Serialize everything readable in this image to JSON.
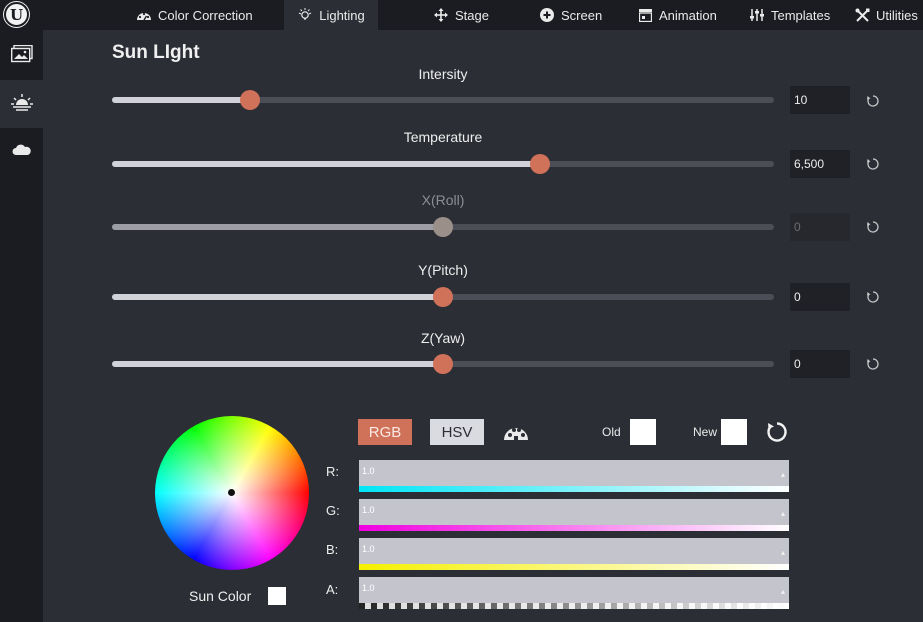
{
  "topbar": {
    "logo": "U",
    "tabs": [
      {
        "label": "Color Correction",
        "icon": "gauge-icon"
      },
      {
        "label": "Lighting",
        "icon": "lightbulb-icon",
        "active": true
      },
      {
        "label": "Stage",
        "icon": "move-arrows-icon"
      },
      {
        "label": "Screen",
        "icon": "plus-circle-icon"
      },
      {
        "label": "Animation",
        "icon": "clapperboard-icon"
      },
      {
        "label": "Templates",
        "icon": "sliders-icon"
      },
      {
        "label": "Utilities",
        "icon": "tools-icon"
      }
    ]
  },
  "leftrail": {
    "items": [
      {
        "icon": "image-gallery-icon"
      },
      {
        "icon": "sunrise-icon",
        "active": true
      },
      {
        "icon": "cloud-icon"
      }
    ]
  },
  "panel": {
    "title": "Sun  LIght",
    "sliders": [
      {
        "label": "Intersity",
        "value": "10",
        "fraction": 0.209,
        "disabled": false
      },
      {
        "label": "Temperature",
        "value": "6,500",
        "fraction": 0.647,
        "disabled": false
      },
      {
        "label": "X(Roll)",
        "value": "0",
        "fraction": 0.5,
        "disabled": true
      },
      {
        "label": "Y(Pitch)",
        "value": "0",
        "fraction": 0.5,
        "disabled": false
      },
      {
        "label": "Z(Yaw)",
        "value": "0",
        "fraction": 0.5,
        "disabled": false
      }
    ]
  },
  "color": {
    "wheel_label": "Sun Color",
    "mode_rgb": "RGB",
    "mode_hsv": "HSV",
    "old_label": "Old",
    "new_label": "New",
    "old_color": "#ffffff",
    "new_color": "#ffffff",
    "channels": [
      {
        "label": "R:",
        "value": "1.0",
        "color": "#00e5f5"
      },
      {
        "label": "G:",
        "value": "1.0",
        "color": "#f000e0"
      },
      {
        "label": "B:",
        "value": "1.0",
        "color": "#f5f000"
      },
      {
        "label": "A:",
        "value": "1.0",
        "color": "checker"
      }
    ]
  },
  "colors": {
    "accent": "#d0715a",
    "background": "#2b2e35",
    "rail": "#1a1c21"
  }
}
